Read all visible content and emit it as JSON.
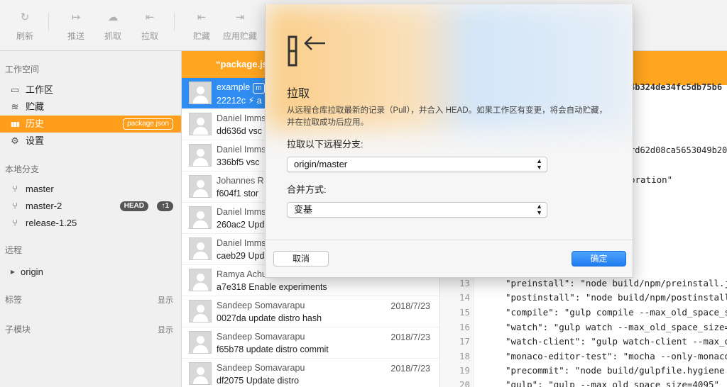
{
  "toolbar": {
    "buttons": [
      {
        "label": "刷新",
        "icon": "refresh-icon",
        "glyph": "↻"
      },
      {
        "label": "推送",
        "icon": "push-icon",
        "glyph": "↦"
      },
      {
        "label": "抓取",
        "icon": "fetch-cloud-icon",
        "glyph": "☁"
      },
      {
        "label": "拉取",
        "icon": "pull-icon",
        "glyph": "⇤"
      },
      {
        "label": "贮藏",
        "icon": "stash-icon",
        "glyph": "⇤"
      },
      {
        "label": "应用贮藏",
        "icon": "apply-stash-icon",
        "glyph": "⇥"
      }
    ]
  },
  "sidebar": {
    "workspace_title": "工作空间",
    "workspace_items": [
      {
        "label": "工作区",
        "icon": "folder-icon",
        "glyph": "▭"
      },
      {
        "label": "贮藏",
        "icon": "stack-icon",
        "glyph": "≋"
      },
      {
        "label": "历史",
        "icon": "history-icon",
        "glyph": "▮▮▮",
        "badge": "package.json",
        "active": true
      },
      {
        "label": "设置",
        "icon": "gear-icon",
        "glyph": "⚙"
      }
    ],
    "branches_title": "本地分支",
    "branches": [
      {
        "label": "master"
      },
      {
        "label": "master-2",
        "head": "HEAD",
        "ahead": "↑1"
      },
      {
        "label": "release-1.25"
      }
    ],
    "remote_title": "远程",
    "remote_items": [
      {
        "label": "origin"
      }
    ],
    "tags_title": "标签",
    "tags_show": "显示",
    "submodules_title": "子模块",
    "submodules_show": "显示"
  },
  "commits": {
    "header": "“package.js",
    "rows": [
      {
        "author": "example",
        "tag": "m",
        "hash": "22212c",
        "msg": "⚡ a",
        "date": "",
        "selected": true
      },
      {
        "author": "Daniel Imms",
        "hash": "dd636d",
        "msg": "vsc",
        "date": ""
      },
      {
        "author": "Daniel Imms",
        "hash": "336bf5",
        "msg": "vsc",
        "date": ""
      },
      {
        "author": "Johannes R",
        "hash": "f604f1",
        "msg": "stor",
        "date": ""
      },
      {
        "author": "Daniel Imms",
        "hash": "260ac2",
        "msg": "Upd",
        "date": ""
      },
      {
        "author": "Daniel Imms",
        "hash": "caeb29",
        "msg": "Upd",
        "date": ""
      },
      {
        "author": "Ramya Achu",
        "hash": "a7e318",
        "msg": "Enable experiments",
        "date": ""
      },
      {
        "author": "Sandeep Somavarapu",
        "hash": "0027da",
        "msg": "update distro hash",
        "date": "2018/7/23"
      },
      {
        "author": "Sandeep Somavarapu",
        "hash": "f65b78",
        "msg": "update distro commit",
        "date": "2018/7/23"
      },
      {
        "author": "Sandeep Somavarapu",
        "hash": "df2075",
        "msg": "Update distro",
        "date": "2018/7/23"
      }
    ]
  },
  "diff": {
    "hash": "4b324de34fc5db75b6",
    "hash2": "rd62d08ca5653049b20",
    "frag": "oration\"",
    "lines": [
      {
        "n": "13",
        "code": "\"preinstall\": \"node build/npm/preinstall.j"
      },
      {
        "n": "14",
        "code": "\"postinstall\": \"node build/npm/postinstall"
      },
      {
        "n": "15",
        "code": "\"compile\": \"gulp compile --max_old_space_s"
      },
      {
        "n": "16",
        "code": "\"watch\": \"gulp watch --max_old_space_size="
      },
      {
        "n": "17",
        "code": "\"watch-client\": \"gulp watch-client --max_o"
      },
      {
        "n": "18",
        "code": "\"monaco-editor-test\": \"mocha --only-monaco"
      },
      {
        "n": "19",
        "code": "\"precommit\": \"node build/gulpfile.hygiene"
      },
      {
        "n": "20",
        "code": "\"gulp\": \"gulp --max_old_space_size=4095\""
      }
    ]
  },
  "dialog": {
    "icon": "pull-icon",
    "title": "拉取",
    "description": "从远程仓库拉取最新的记录（Pull），并合入 HEAD。如果工作区有变更，将会自动贮藏，并在拉取成功后应用。",
    "branch_label": "拉取以下远程分支:",
    "branch_value": "origin/master",
    "merge_label": "合并方式:",
    "merge_value": "变基",
    "cancel": "取消",
    "ok": "确定"
  }
}
